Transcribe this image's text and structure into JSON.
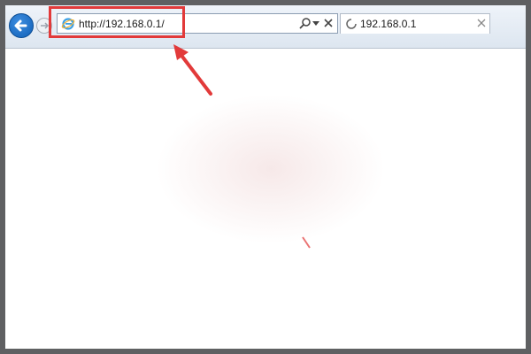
{
  "browser": {
    "address_bar": {
      "url": "http://192.168.0.1/"
    },
    "tab": {
      "title": "192.168.0.1"
    }
  },
  "icons": {
    "back": "back-arrow-icon",
    "forward": "forward-arrow-icon",
    "site": "ie-logo-icon",
    "search": "search-icon",
    "dropdown": "chevron-down-icon",
    "stop": "close-icon",
    "loading": "loading-icon",
    "tab_close": "close-icon"
  },
  "colors": {
    "annotation": "#e23a3a",
    "back_button": "#1a6fcb",
    "frame": "#5f6062"
  }
}
